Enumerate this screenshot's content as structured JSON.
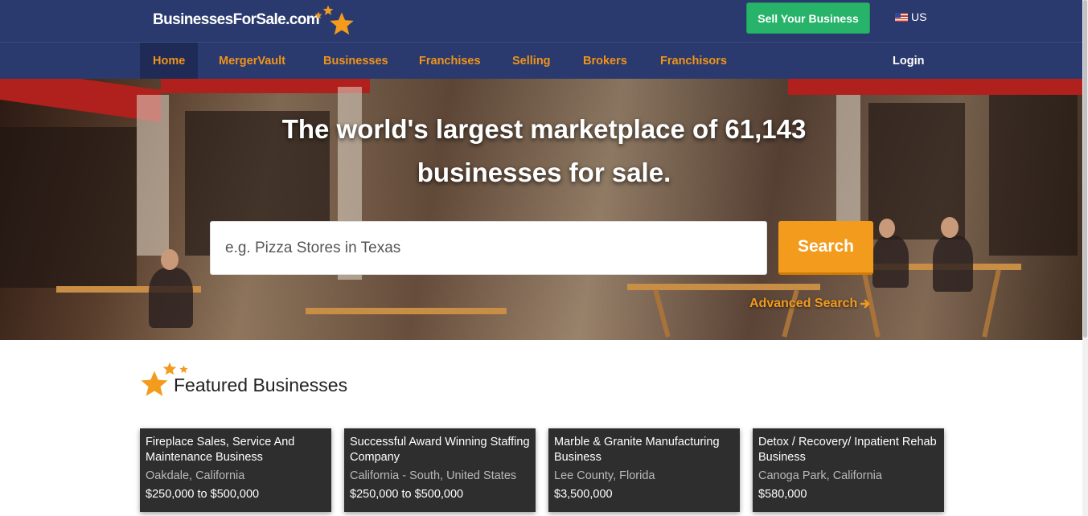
{
  "header": {
    "logo_text": "BusinessesForSale.com",
    "sell_button": "Sell Your Business",
    "locale": "US"
  },
  "nav": {
    "items": [
      "Home",
      "MergerVault",
      "Businesses",
      "Franchises",
      "Selling",
      "Brokers",
      "Franchisors"
    ],
    "active": "Home",
    "login": "Login"
  },
  "hero": {
    "title_line1": "The world's largest marketplace of 61,143",
    "title_line2": "businesses for sale.",
    "search_placeholder": "e.g. Pizza Stores in Texas",
    "search_button": "Search",
    "advanced_search": "Advanced Search"
  },
  "featured": {
    "heading": "Featured Businesses",
    "cards": [
      {
        "title": "Fireplace Sales, Service And Maintenance Business",
        "location": "Oakdale, California",
        "price": "$250,000 to $500,000"
      },
      {
        "title": "Successful Award Winning Staffing Company",
        "location": "California - South, United States",
        "price": "$250,000 to $500,000"
      },
      {
        "title": "Marble & Granite Manufacturing Business",
        "location": "Lee County, Florida",
        "price": "$3,500,000"
      },
      {
        "title": "Detox / Recovery/ Inpatient Rehab Business",
        "location": "Canoga Park, California",
        "price": "$580,000"
      }
    ]
  },
  "colors": {
    "header_bg": "#2b3a6e",
    "accent_orange": "#f39b1c",
    "sell_green": "#27b36a",
    "card_bg": "#2e2e2e"
  },
  "icons": {
    "logo_stars": "stars-icon",
    "flag": "us-flag-icon",
    "advanced_arrow": "arrow-right-icon",
    "featured_stars": "stars-icon"
  }
}
